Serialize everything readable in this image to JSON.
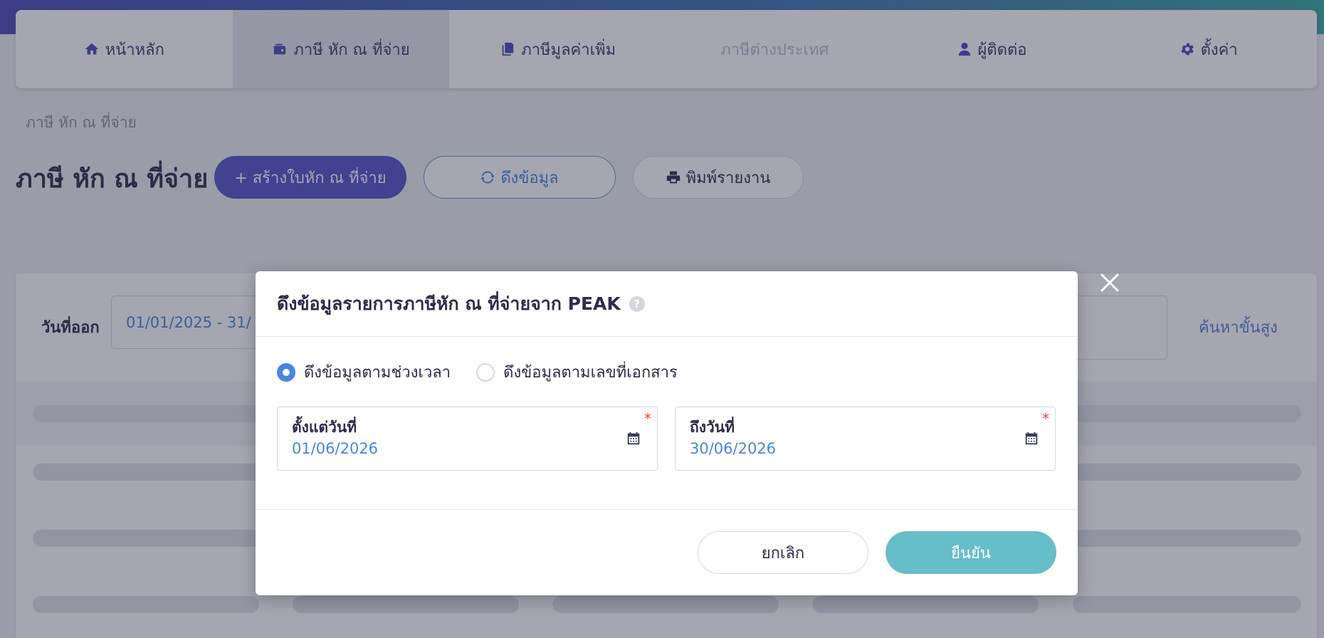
{
  "nav": {
    "items": [
      {
        "label": "หน้าหลัก",
        "icon": "home-icon"
      },
      {
        "label": "ภาษี หัก ณ ที่จ่าย",
        "icon": "wallet-icon"
      },
      {
        "label": "ภาษีมูลค่าเพิ่ม",
        "icon": "documents-icon"
      },
      {
        "label": "ภาษีต่างประเทศ",
        "icon": ""
      },
      {
        "label": "ผู้ติดต่อ",
        "icon": "user-icon"
      },
      {
        "label": "ตั้งค่า",
        "icon": "gear-icon"
      }
    ],
    "active_index": 1,
    "disabled_index": 3
  },
  "breadcrumb": "ภาษี หัก ณ ที่จ่าย",
  "page": {
    "title": "ภาษี หัก ณ ที่จ่าย",
    "create_button": "+ สร้างใบหัก ณ ที่จ่าย",
    "fetch_button": "ดึงข้อมูล",
    "print_button": "พิมพ์รายงาน"
  },
  "filter": {
    "label": "วันที่ออก",
    "value": "01/01/2025 - 31/",
    "advanced_search": "ค้นหาขั้นสูง"
  },
  "modal": {
    "title": "ดึงข้อมูลรายการภาษีหัก ณ ที่จ่ายจาก PEAK",
    "help": "?",
    "radios": [
      {
        "label": "ดึงข้อมูลตามช่วงเวลา",
        "checked": true
      },
      {
        "label": "ดึงข้อมูลตามเลขที่เอกสาร",
        "checked": false
      }
    ],
    "date_from": {
      "label": "ตั้งแต่วันที่",
      "value": "01/06/2026",
      "required": "*"
    },
    "date_to": {
      "label": "ถึงวันที่",
      "value": "30/06/2026",
      "required": "*"
    },
    "cancel": "ยกเลิก",
    "confirm": "ยืนยัน"
  },
  "colors": {
    "primary": "#5454c9",
    "accent_blue": "#4a86d8",
    "confirm": "#66bec8",
    "required": "#e0453a"
  }
}
